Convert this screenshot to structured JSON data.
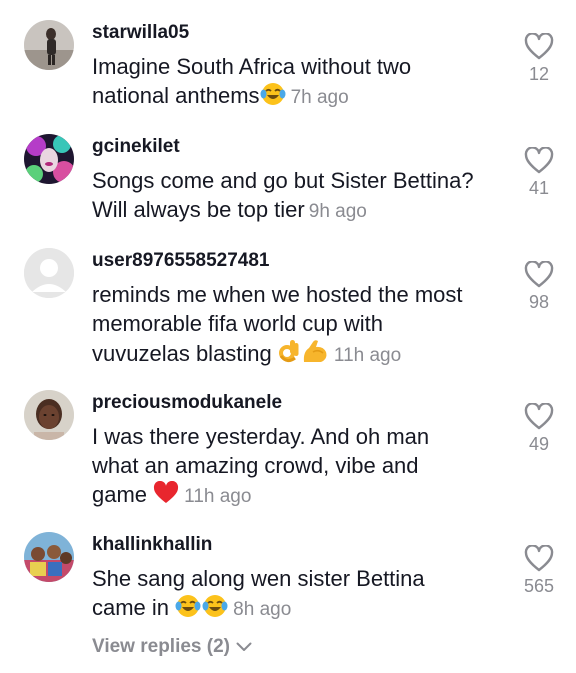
{
  "comments": [
    {
      "username": "starwilla05",
      "lines": [
        "Imagine South Africa without two",
        "national anthems"
      ],
      "emojis": [
        "face-with-tears-of-joy-icon"
      ],
      "time": "7h ago",
      "likes": "12"
    },
    {
      "username": "gcinekilet",
      "lines": [
        "Songs come and go but Sister Bettina?",
        "Will always be top tier"
      ],
      "emojis": [],
      "time": "9h ago",
      "likes": "41"
    },
    {
      "username": "user8976558527481",
      "lines": [
        "reminds me when we hosted the most",
        "memorable fifa world cup with",
        "vuvuzelas blasting"
      ],
      "emojis": [
        "ok-hand-icon",
        "flexed-biceps-icon"
      ],
      "time": "11h ago",
      "likes": "98"
    },
    {
      "username": "preciousmodukanele",
      "lines": [
        "I was there yesterday. And oh man",
        "what an amazing crowd, vibe and",
        "game"
      ],
      "emojis": [
        "red-heart-icon"
      ],
      "time": "11h ago",
      "likes": "49"
    },
    {
      "username": "khallinkhallin",
      "lines": [
        "She sang along wen sister Bettina",
        "came in"
      ],
      "emojis": [
        "face-with-tears-of-joy-icon",
        "face-with-tears-of-joy-icon"
      ],
      "time": "8h ago",
      "likes": "565"
    }
  ],
  "view_replies": "View replies (2)",
  "colors": {
    "text": "#161823",
    "muted": "#8a8b91",
    "heart_outline": "#8a8b91"
  }
}
